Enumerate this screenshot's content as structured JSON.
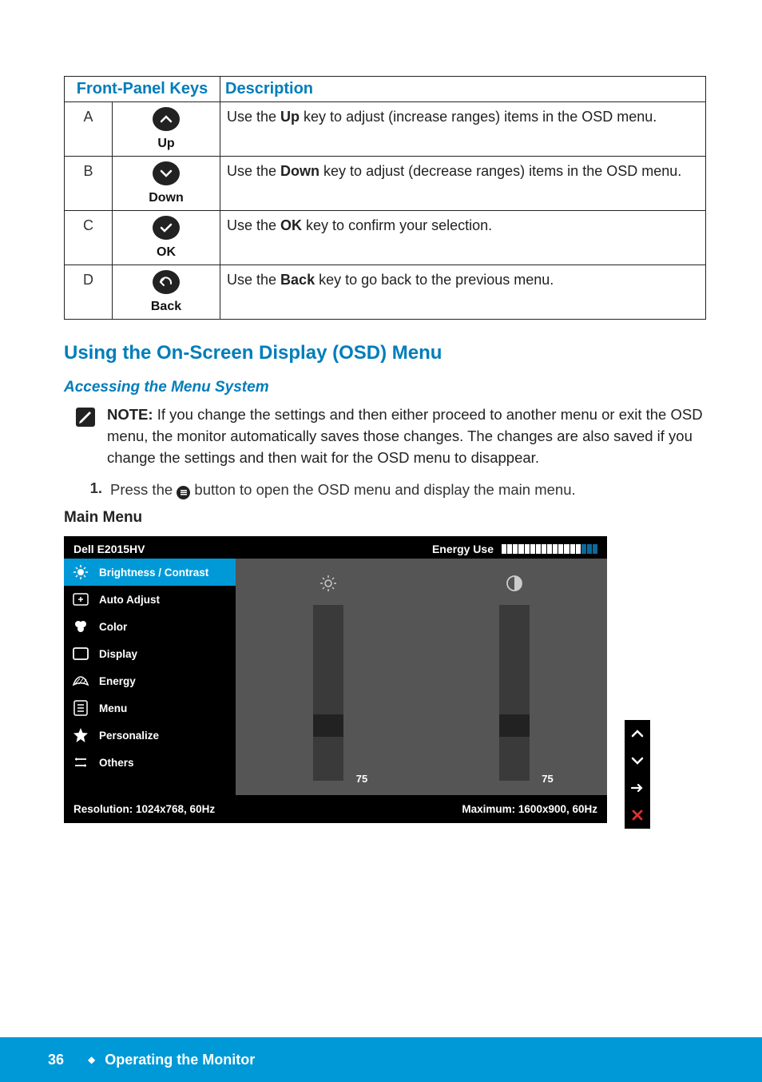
{
  "table": {
    "headers": [
      "Front-Panel Keys",
      "Description"
    ],
    "rows": [
      {
        "letter": "A",
        "keyLabel": "Up",
        "desc_pre": "Use the ",
        "desc_bold": "Up",
        "desc_post": " key to adjust (increase ranges) items in the OSD menu."
      },
      {
        "letter": "B",
        "keyLabel": "Down",
        "desc_pre": "Use the ",
        "desc_bold": "Down",
        "desc_post": " key to adjust (decrease ranges) items in the OSD menu."
      },
      {
        "letter": "C",
        "keyLabel": "OK",
        "desc_pre": "Use the ",
        "desc_bold": "OK",
        "desc_post": " key to confirm your selection."
      },
      {
        "letter": "D",
        "keyLabel": "Back",
        "desc_pre": "Use the ",
        "desc_bold": "Back",
        "desc_post": " key to go back to the previous menu."
      }
    ]
  },
  "section_h2": "Using the On-Screen Display (OSD) Menu",
  "section_h3": "Accessing the Menu System",
  "note": {
    "label": "NOTE:",
    "text": " If you change the settings and then either proceed to another menu or exit the OSD menu, the monitor automatically saves those changes. The changes are also saved if you change the settings and then wait for the OSD menu to disappear."
  },
  "step1": {
    "num": "1.",
    "pre": "Press the ",
    "post": " button to open the OSD menu and display the main menu."
  },
  "main_menu_label": "Main Menu",
  "osd": {
    "model": "Dell E2015HV",
    "energy_label": "Energy Use",
    "menu": [
      "Brightness / Contrast",
      "Auto Adjust",
      "Color",
      "Display",
      "Energy",
      "Menu",
      "Personalize",
      "Others"
    ],
    "brightness_value": "75",
    "contrast_value": "75",
    "resolution": "Resolution: 1024x768, 60Hz",
    "maximum": "Maximum: 1600x900, 60Hz"
  },
  "footer": {
    "page": "36",
    "title": "Operating the Monitor"
  }
}
